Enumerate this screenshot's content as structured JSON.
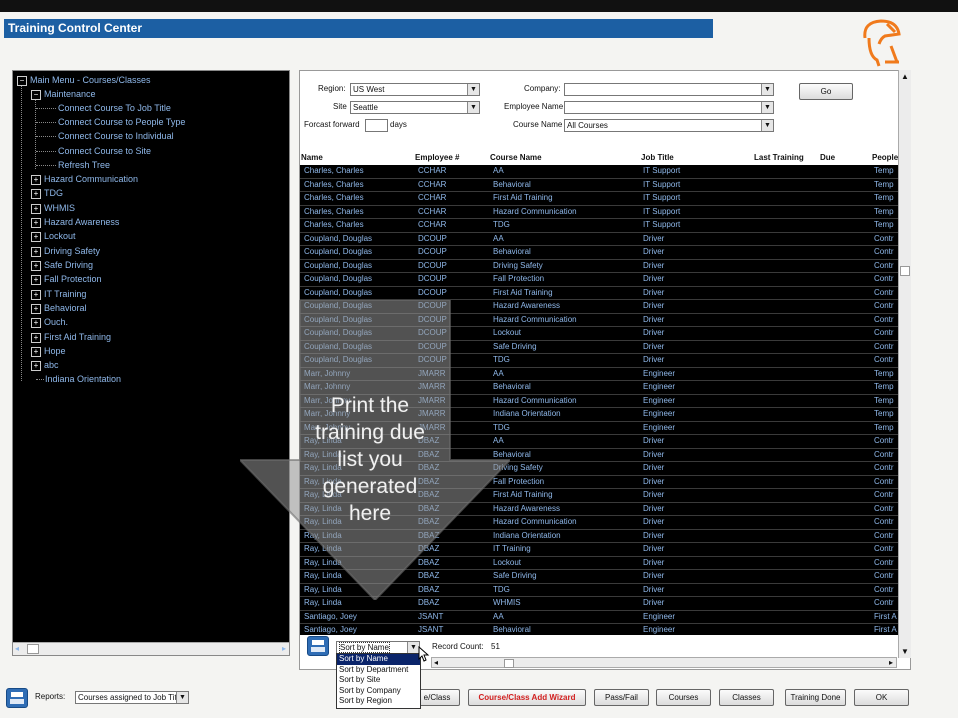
{
  "window": {
    "title": "Training Control Center"
  },
  "tree": {
    "root": "Main Menu - Courses/Classes",
    "maintenance": {
      "label": "Maintenance",
      "children": [
        "Connect Course To Job Title",
        "Connect Course to People Type",
        "Connect Course to Individual",
        "Connect Course to Site",
        "Refresh Tree"
      ]
    },
    "items": [
      "Hazard Communication",
      "TDG",
      "WHMIS",
      "Hazard Awareness",
      "Lockout",
      "Driving Safety",
      "Safe Driving",
      "Fall Protection",
      "IT Training",
      "Behavioral",
      "Ouch.",
      "First Aid Training",
      "Hope",
      "abc",
      "Indiana Orientation"
    ]
  },
  "filters": {
    "region_label": "Region:",
    "region_value": "US West",
    "site_label": "Site",
    "site_value": "Seattle",
    "forecast_label": "Forcast forward",
    "forecast_value": "",
    "days_label": "days",
    "company_label": "Company:",
    "company_value": "",
    "employee_label": "Employee Name",
    "employee_value": "",
    "course_label": "Course Name",
    "course_value": "All Courses",
    "go_label": "Go"
  },
  "grid": {
    "columns": [
      "Name",
      "Employee #",
      "Course Name",
      "Job Title",
      "Last Training",
      "Due",
      "People"
    ],
    "rows": [
      [
        "Charles, Charles",
        "CCHAR",
        "AA",
        "IT Support",
        "Temp"
      ],
      [
        "Charles, Charles",
        "CCHAR",
        "Behavioral",
        "IT Support",
        "Temp"
      ],
      [
        "Charles, Charles",
        "CCHAR",
        "First Aid Training",
        "IT Support",
        "Temp"
      ],
      [
        "Charles, Charles",
        "CCHAR",
        "Hazard Communication",
        "IT Support",
        "Temp"
      ],
      [
        "Charles, Charles",
        "CCHAR",
        "TDG",
        "IT Support",
        "Temp"
      ],
      [
        "Coupland, Douglas",
        "DCOUP",
        "AA",
        "Driver",
        "Contr"
      ],
      [
        "Coupland, Douglas",
        "DCOUP",
        "Behavioral",
        "Driver",
        "Contr"
      ],
      [
        "Coupland, Douglas",
        "DCOUP",
        "Driving Safety",
        "Driver",
        "Contr"
      ],
      [
        "Coupland, Douglas",
        "DCOUP",
        "Fall Protection",
        "Driver",
        "Contr"
      ],
      [
        "Coupland, Douglas",
        "DCOUP",
        "First Aid Training",
        "Driver",
        "Contr"
      ],
      [
        "Coupland, Douglas",
        "DCOUP",
        "Hazard Awareness",
        "Driver",
        "Contr"
      ],
      [
        "Coupland, Douglas",
        "DCOUP",
        "Hazard Communication",
        "Driver",
        "Contr"
      ],
      [
        "Coupland, Douglas",
        "DCOUP",
        "Lockout",
        "Driver",
        "Contr"
      ],
      [
        "Coupland, Douglas",
        "DCOUP",
        "Safe Driving",
        "Driver",
        "Contr"
      ],
      [
        "Coupland, Douglas",
        "DCOUP",
        "TDG",
        "Driver",
        "Contr"
      ],
      [
        "Marr, Johnny",
        "JMARR",
        "AA",
        "Engineer",
        "Temp"
      ],
      [
        "Marr, Johnny",
        "JMARR",
        "Behavioral",
        "Engineer",
        "Temp"
      ],
      [
        "Marr, Johnny",
        "JMARR",
        "Hazard Communication",
        "Engineer",
        "Temp"
      ],
      [
        "Marr, Johnny",
        "JMARR",
        "Indiana Orientation",
        "Engineer",
        "Temp"
      ],
      [
        "Marr, Johnny",
        "JMARR",
        "TDG",
        "Engineer",
        "Temp"
      ],
      [
        "Ray, Linda",
        "DBAZ",
        "AA",
        "Driver",
        "Contr"
      ],
      [
        "Ray, Linda",
        "DBAZ",
        "Behavioral",
        "Driver",
        "Contr"
      ],
      [
        "Ray, Linda",
        "DBAZ",
        "Driving Safety",
        "Driver",
        "Contr"
      ],
      [
        "Ray, Linda",
        "DBAZ",
        "Fall Protection",
        "Driver",
        "Contr"
      ],
      [
        "Ray, Linda",
        "DBAZ",
        "First Aid Training",
        "Driver",
        "Contr"
      ],
      [
        "Ray, Linda",
        "DBAZ",
        "Hazard Awareness",
        "Driver",
        "Contr"
      ],
      [
        "Ray, Linda",
        "DBAZ",
        "Hazard Communication",
        "Driver",
        "Contr"
      ],
      [
        "Ray, Linda",
        "DBAZ",
        "Indiana Orientation",
        "Driver",
        "Contr"
      ],
      [
        "Ray, Linda",
        "DBAZ",
        "IT Training",
        "Driver",
        "Contr"
      ],
      [
        "Ray, Linda",
        "DBAZ",
        "Lockout",
        "Driver",
        "Contr"
      ],
      [
        "Ray, Linda",
        "DBAZ",
        "Safe Driving",
        "Driver",
        "Contr"
      ],
      [
        "Ray, Linda",
        "DBAZ",
        "TDG",
        "Driver",
        "Contr"
      ],
      [
        "Ray, Linda",
        "DBAZ",
        "WHMIS",
        "Driver",
        "Contr"
      ],
      [
        "Santiago, Joey",
        "JSANT",
        "AA",
        "Engineer",
        "First A"
      ],
      [
        "Santiago, Joey",
        "JSANT",
        "Behavioral",
        "Engineer",
        "First A"
      ]
    ]
  },
  "sort": {
    "selected": "Sort by Name",
    "options": [
      "Sort by Name",
      "Sort by Department",
      "Sort by Site",
      "Sort by Company",
      "Sort by Region"
    ],
    "record_count_label": "Record Count:",
    "record_count": "51"
  },
  "overlay": {
    "lines": [
      "Print the",
      "training due",
      "list you",
      "generated",
      "here"
    ]
  },
  "footer": {
    "reports_label": "Reports:",
    "reports_value": "Courses assigned to Job Title",
    "buttons": [
      "e/Class",
      "Course/Class Add Wizard",
      "Pass/Fail",
      "Courses",
      "Classes",
      "Training Done",
      "OK"
    ]
  },
  "colors": {
    "title_bg": "#1c5fa3",
    "grid_bg": "#000000",
    "grid_text": "#8fb8ea",
    "wizard_text": "#d22020",
    "logo": "#f07a1c"
  }
}
